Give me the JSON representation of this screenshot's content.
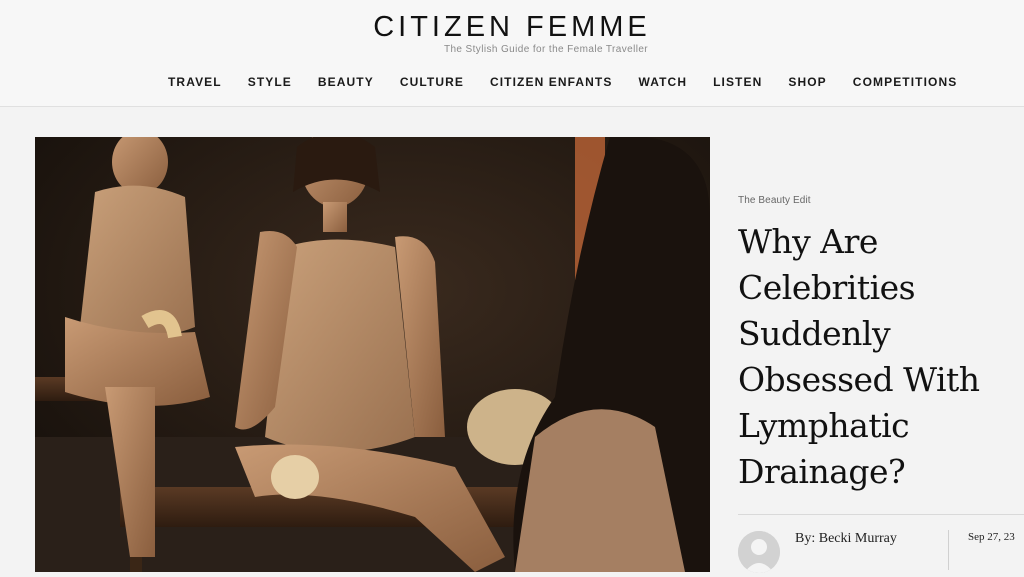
{
  "header": {
    "logo": "CITIZEN FEMME",
    "tagline": "The Stylish Guide for the Female Traveller",
    "nav": [
      "TRAVEL",
      "STYLE",
      "BEAUTY",
      "CULTURE",
      "CITIZEN ENFANTS",
      "WATCH",
      "LISTEN",
      "SHOP",
      "COMPETITIONS"
    ]
  },
  "article": {
    "category": "The Beauty Edit",
    "title_lines": [
      "Why Are",
      "Celebrities",
      "Suddenly",
      "Obsessed With",
      "Lymphatic",
      "Drainage?"
    ],
    "author": "By: Becki Murray",
    "date": "Sep 27, 23"
  },
  "colors": {
    "background": "#f3f3f3",
    "text": "#111111",
    "muted": "#8a8a8a"
  }
}
